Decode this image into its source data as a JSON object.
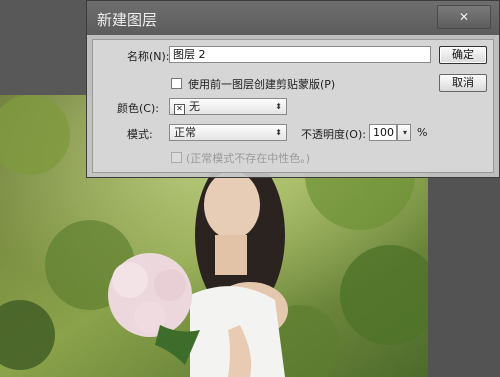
{
  "dialog": {
    "title": "新建图层",
    "name_label": "名称(N):",
    "name_value": "图层 2",
    "clip_checkbox_label": "使用前一图层创建剪贴蒙版(P)",
    "color_label": "颜色(C):",
    "color_value": "无",
    "mode_label": "模式:",
    "mode_value": "正常",
    "opacity_label": "不透明度(O):",
    "opacity_value": "100",
    "opacity_unit": "%",
    "neutral_checkbox_label": "(正常模式不存在中性色。)",
    "ok_label": "确定",
    "cancel_label": "取消",
    "close_glyph": "✕"
  },
  "icons": {
    "color_swatch": "✕",
    "dropdown_arrow": "⌃⌄",
    "opacity_arrow": "▾"
  }
}
